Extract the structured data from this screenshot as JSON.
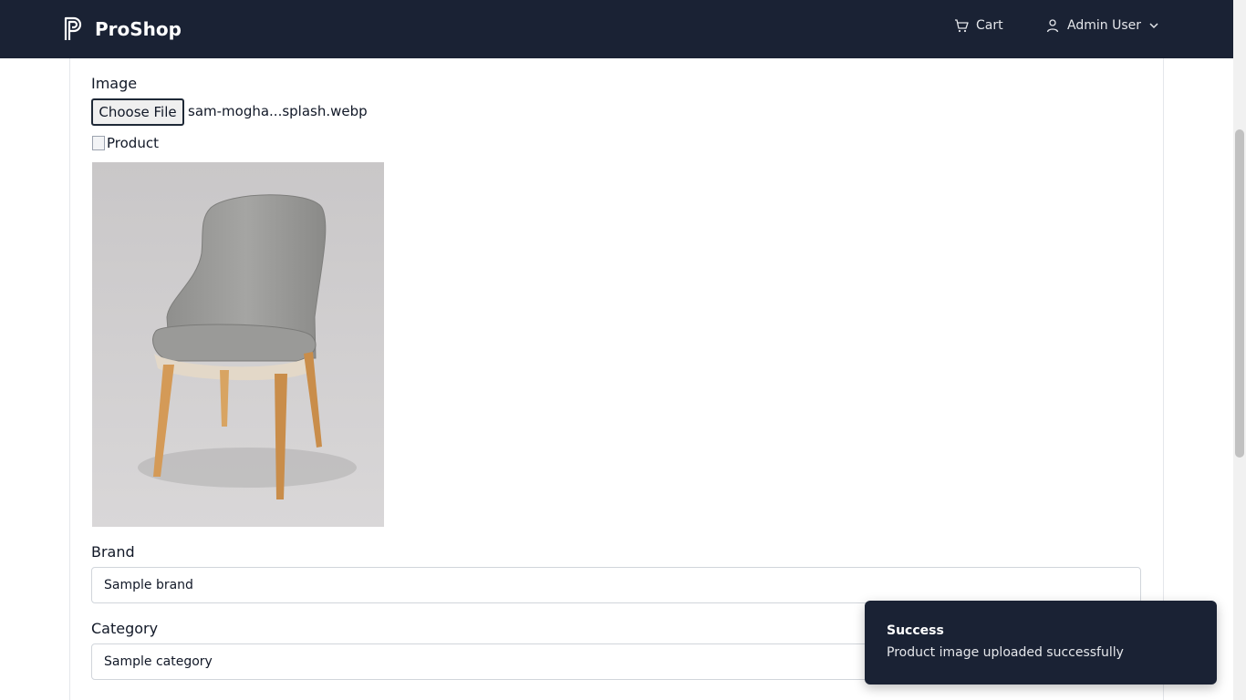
{
  "navbar": {
    "brand": "ProShop",
    "cart_label": "Cart",
    "user_label": "Admin User",
    "background": "#1a2234"
  },
  "form": {
    "image_label": "Image",
    "file_button": "Choose File",
    "file_name": "sam-mogha...splash.webp",
    "broken_image_alt": "Product",
    "brand_label": "Brand",
    "brand_value": "Sample brand",
    "category_label": "Category",
    "category_value": "Sample category"
  },
  "toast": {
    "title": "Success",
    "message": "Product image uploaded successfully"
  },
  "icons": {
    "logo": "proshop-logo-icon",
    "cart": "cart-icon",
    "user": "user-icon",
    "chevron": "chevron-down-icon",
    "broken_image": "broken-image-icon"
  }
}
